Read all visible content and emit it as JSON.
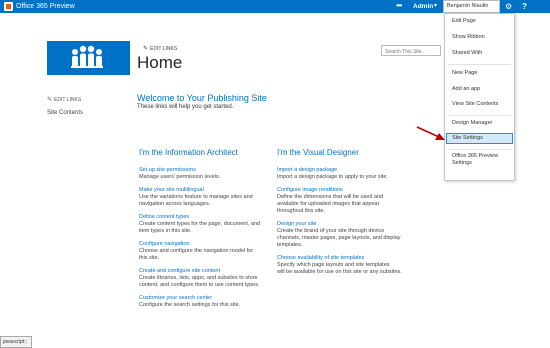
{
  "suitebar": {
    "title": "Office 365 Preview",
    "more_dots": "•••",
    "admin": "Admin",
    "admin_arrow": "▾",
    "user": "Benjamin Niaulin",
    "gear": "⚙",
    "help": "?",
    "color": "#0072c6"
  },
  "site": {
    "edit_links_top": "EDIT LINKS",
    "page_title": "Home",
    "search_placeholder": "Search This Site..."
  },
  "left_nav": {
    "edit_links": "EDIT LINKS",
    "site_contents": "Site Contents"
  },
  "welcome": {
    "title": "Welcome to Your Publishing Site",
    "subtitle": "These links will help you get started."
  },
  "left_column": {
    "heading": "I'm the Information Architect",
    "tasks": [
      {
        "link": "Set up site permissions",
        "desc": [
          "Manage users' permission levels."
        ]
      },
      {
        "link": "Make your site multilingual",
        "desc": [
          "Use the variations feature to manage sites and",
          "navigation across languages."
        ]
      },
      {
        "link": "Define content types",
        "desc": [
          "Create content types for the page, document, and",
          "item types in this site."
        ]
      },
      {
        "link": "Configure navigation",
        "desc": [
          "Choose and configure the navigation model for",
          "this site."
        ]
      },
      {
        "link": "Create and configure site content",
        "desc": [
          "Create libraries, lists, apps, and subsites to store",
          "content, and configure them to use content types."
        ]
      },
      {
        "link": "Customize your search center",
        "desc": [
          "Configure the search settings for this site."
        ]
      }
    ]
  },
  "right_column": {
    "heading": "I'm the Visual Designer",
    "tasks": [
      {
        "link": "Import a design package",
        "desc": [
          "Import a design package to apply to your site."
        ]
      },
      {
        "link": "Configure image renditions",
        "desc": [
          "Define the dimensions that will be used and",
          "available for uploaded images that appear",
          "throughout this site."
        ]
      },
      {
        "link": "Design your site",
        "desc": [
          "Create the brand of your site through device",
          "channels, master pages, page layouts, and display",
          "templates."
        ]
      },
      {
        "link": "Choose availability of site templates",
        "desc": [
          "Specify which page layouts and site templates",
          "will be available for use on this site or any subsites."
        ]
      }
    ]
  },
  "menu": {
    "items": [
      "Edit Page",
      "Show Ribbon",
      "Shared With",
      "New Page",
      "Add an app",
      "View Site Contents",
      "Design Manager",
      "Site Settings",
      "Office 365 Preview",
      "Settings"
    ]
  },
  "status": {
    "text": "javascript:;"
  }
}
